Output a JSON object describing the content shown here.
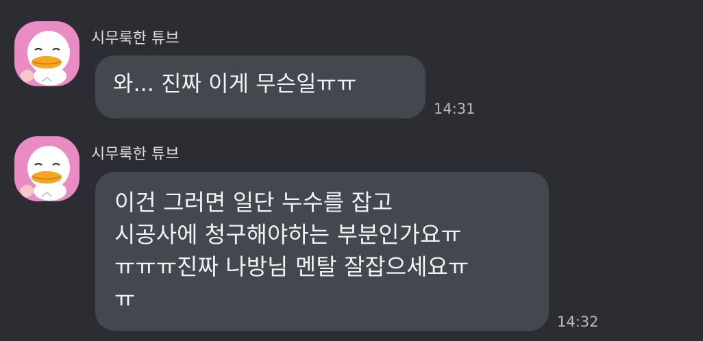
{
  "chat": {
    "messages": [
      {
        "sender": "시무룩한 튜브",
        "avatar_icon": "sad-duck-tube-icon",
        "lines": [
          "와... 진짜 이게 무슨일ㅠㅠ"
        ],
        "time": "14:31"
      },
      {
        "sender": "시무룩한 튜브",
        "avatar_icon": "sad-duck-tube-icon",
        "lines": [
          "이건 그러면 일단 누수를 잡고",
          "시공사에 청구해야하는 부분인가요ㅠ",
          "ㅠㅠㅠ진짜 나방님 멘탈 잘잡으세요ㅠ",
          "ㅠ"
        ],
        "time": "14:32"
      }
    ]
  },
  "colors": {
    "background": "#2b2d33",
    "bubble": "#45474e",
    "avatar_bg": "#e98cc4"
  }
}
